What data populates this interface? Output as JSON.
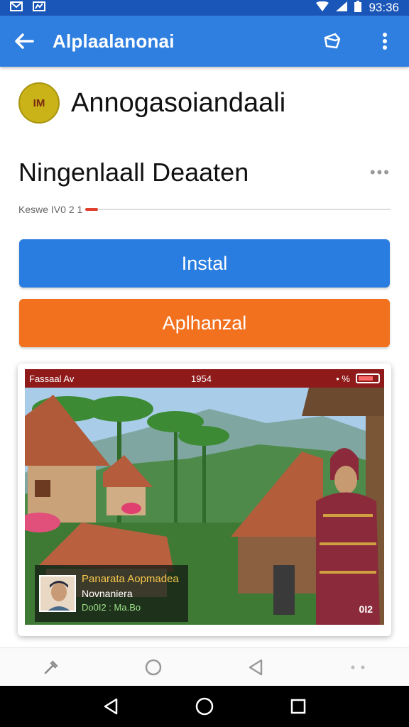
{
  "status_bar": {
    "time": "93:36"
  },
  "app_bar": {
    "title": "Alplaalanonai"
  },
  "app": {
    "logo_text": "IM",
    "name": "Annogasoiandaali"
  },
  "developer": {
    "name": "Ningenlaall Deaaten",
    "meta": "Keswe IV0 2 1"
  },
  "buttons": {
    "install": "Instal",
    "secondary": "Aplhanzal"
  },
  "screenshot": {
    "status_left": "Fassaal Av",
    "status_time": "1954",
    "status_right": "• %",
    "overlay_title": "Panarata Aopmadea",
    "overlay_subtitle": "Novnaniera",
    "overlay_meta": "Do0I2 : Ma.Bo",
    "corner_badge": "0I2"
  },
  "colors": {
    "primary": "#2f7fe0",
    "install": "#2a7de0",
    "secondary": "#f2711f",
    "status_bar": "#1a56b8"
  }
}
